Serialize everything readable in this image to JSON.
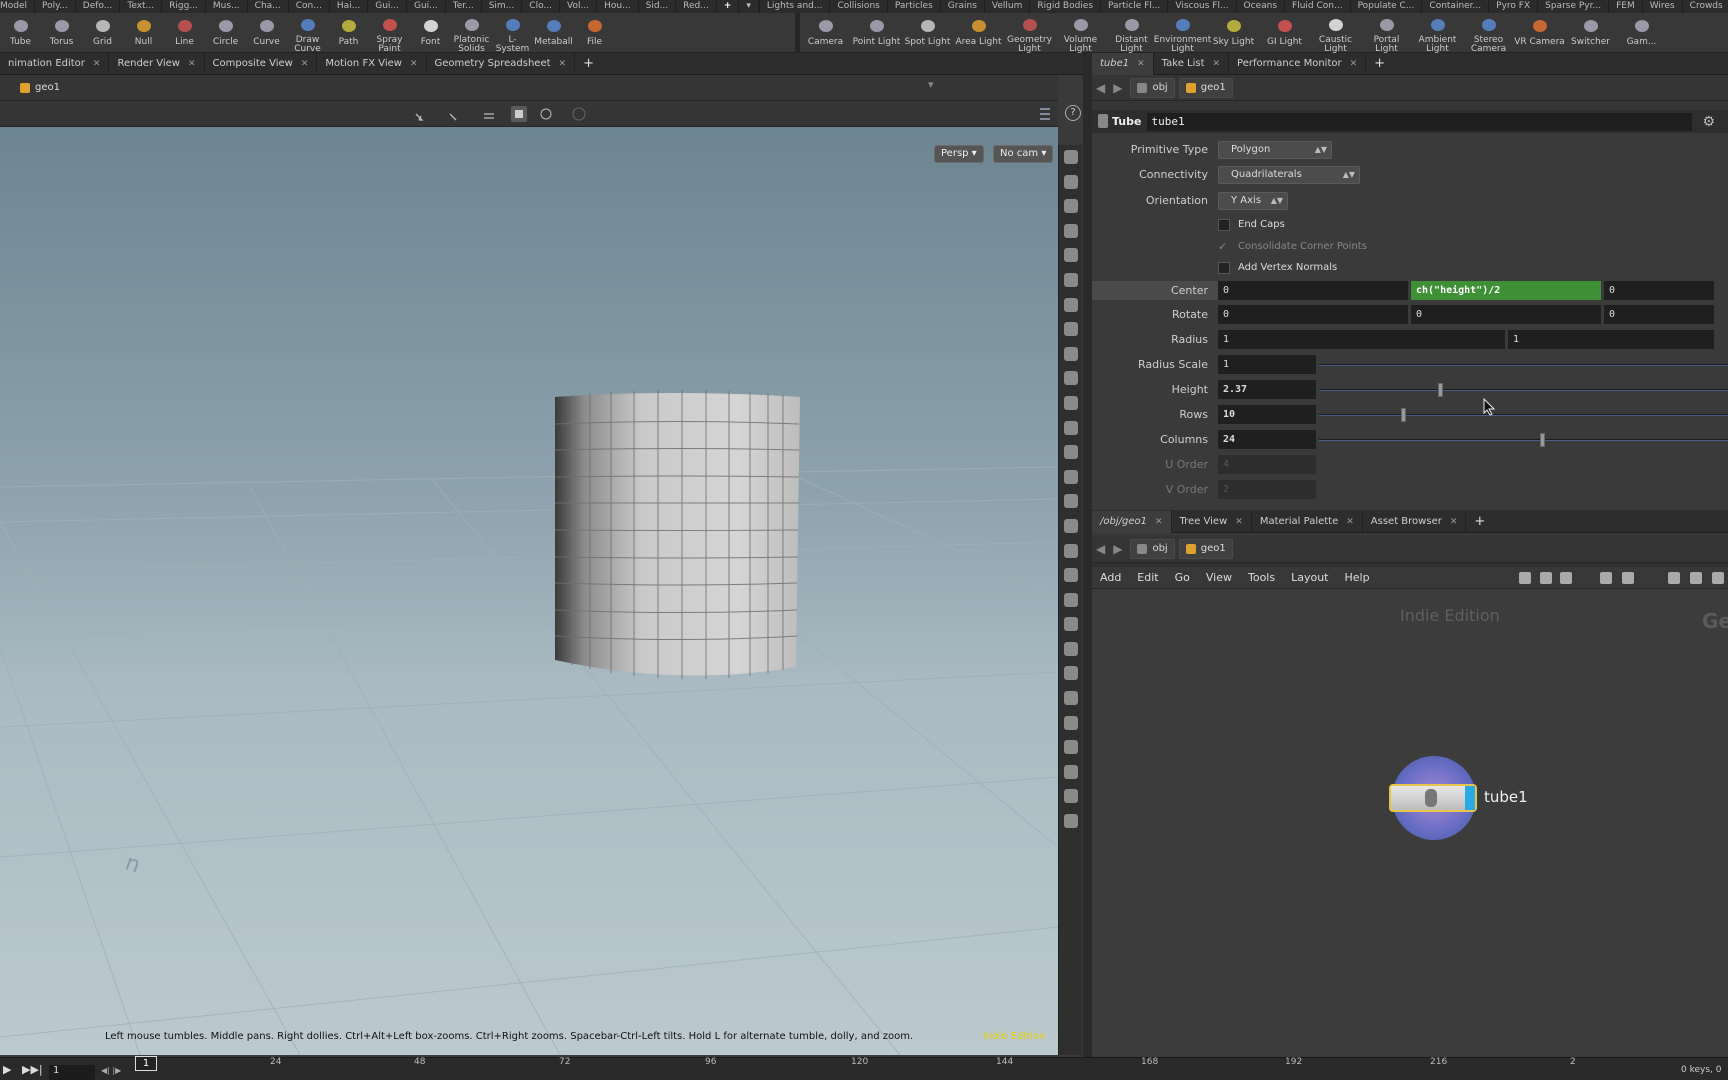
{
  "shelf_tabs_left": [
    "Model",
    "Poly...",
    "Defo...",
    "Text...",
    "Rigg...",
    "Mus...",
    "Cha...",
    "Con...",
    "Hai...",
    "Gui...",
    "Gui...",
    "Ter...",
    "Sim...",
    "Clo...",
    "Vol...",
    "Hou...",
    "Sid...",
    "Red..."
  ],
  "shelf_tabs_right": [
    "Lights and...",
    "Collisions",
    "Particles",
    "Grains",
    "Vellum",
    "Rigid Bodies",
    "Particle Fl...",
    "Viscous Fl...",
    "Oceans",
    "Fluid Con...",
    "Populate C...",
    "Container...",
    "Pyro FX",
    "Sparse Pyr...",
    "FEM",
    "Wires",
    "Crowds"
  ],
  "shelf_add": "+",
  "tools_left": [
    {
      "label": "Tube",
      "icon": "tube-icon"
    },
    {
      "label": "Torus",
      "icon": "torus-icon"
    },
    {
      "label": "Grid",
      "icon": "grid-icon"
    },
    {
      "label": "Null",
      "icon": "null-icon"
    },
    {
      "label": "Line",
      "icon": "line-icon"
    },
    {
      "label": "Circle",
      "icon": "circle-icon"
    },
    {
      "label": "Curve",
      "icon": "curve-icon"
    },
    {
      "label": "Draw Curve",
      "icon": "draw-curve-icon"
    },
    {
      "label": "Path",
      "icon": "path-icon"
    },
    {
      "label": "Spray Paint",
      "icon": "spray-paint-icon"
    },
    {
      "label": "Font",
      "icon": "font-icon"
    },
    {
      "label": "Platonic Solids",
      "icon": "platonic-solids-icon"
    },
    {
      "label": "L-System",
      "icon": "l-system-icon"
    },
    {
      "label": "Metaball",
      "icon": "metaball-icon"
    },
    {
      "label": "File",
      "icon": "file-icon"
    }
  ],
  "tools_right": [
    {
      "label": "Camera",
      "icon": "camera-icon"
    },
    {
      "label": "Point Light",
      "icon": "point-light-icon"
    },
    {
      "label": "Spot Light",
      "icon": "spot-light-icon"
    },
    {
      "label": "Area Light",
      "icon": "area-light-icon"
    },
    {
      "label": "Geometry Light",
      "icon": "geometry-light-icon"
    },
    {
      "label": "Volume Light",
      "icon": "volume-light-icon"
    },
    {
      "label": "Distant Light",
      "icon": "distant-light-icon"
    },
    {
      "label": "Environment Light",
      "icon": "environment-light-icon"
    },
    {
      "label": "Sky Light",
      "icon": "sky-light-icon"
    },
    {
      "label": "GI Light",
      "icon": "gi-light-icon"
    },
    {
      "label": "Caustic Light",
      "icon": "caustic-light-icon"
    },
    {
      "label": "Portal Light",
      "icon": "portal-light-icon"
    },
    {
      "label": "Ambient Light",
      "icon": "ambient-light-icon"
    },
    {
      "label": "Stereo Camera",
      "icon": "stereo-camera-icon"
    },
    {
      "label": "VR Camera",
      "icon": "vr-camera-icon"
    },
    {
      "label": "Switcher",
      "icon": "switcher-icon"
    },
    {
      "label": "Gam...",
      "icon": "gamepad-camera-icon"
    }
  ],
  "viewer_tabs": [
    "nimation Editor",
    "Render View",
    "Composite View",
    "Motion FX View",
    "Geometry Spreadsheet"
  ],
  "viewer_path": "geo1",
  "viewport": {
    "persp": "Persp ▾",
    "cam": "No cam ▾",
    "help": "Left mouse tumbles. Middle pans. Right dollies. Ctrl+Alt+Left box-zooms. Ctrl+Right zooms. Spacebar-Ctrl-Left tilts. Hold L for alternate tumble, dolly, and zoom.",
    "indie": "Indie Edition",
    "ground_label": "n"
  },
  "param_tabs": [
    "tube1",
    "Take List",
    "Performance Monitor"
  ],
  "param_path": [
    "obj",
    "geo1"
  ],
  "node": {
    "type": "Tube",
    "name": "tube1"
  },
  "params": {
    "primitive_type": {
      "label": "Primitive Type",
      "value": "Polygon"
    },
    "connectivity": {
      "label": "Connectivity",
      "value": "Quadrilaterals"
    },
    "orientation": {
      "label": "Orientation",
      "value": "Y Axis"
    },
    "end_caps": {
      "label": "End Caps",
      "checked": false
    },
    "consolidate": {
      "label": "Consolidate Corner Points",
      "checked": true
    },
    "add_vertex_normals": {
      "label": "Add Vertex Normals",
      "checked": false
    },
    "center": {
      "label": "Center",
      "x": "0",
      "y": "ch(\"height\")/2",
      "z": "0"
    },
    "rotate": {
      "label": "Rotate",
      "x": "0",
      "y": "0",
      "z": "0"
    },
    "radius": {
      "label": "Radius",
      "a": "1",
      "b": "1"
    },
    "radius_scale": {
      "label": "Radius Scale",
      "value": "1"
    },
    "height": {
      "label": "Height",
      "value": "2.37",
      "fraction": 0.29
    },
    "rows": {
      "label": "Rows",
      "value": "10",
      "fraction": 0.2
    },
    "columns": {
      "label": "Columns",
      "value": "24",
      "fraction": 0.54
    },
    "u_order": {
      "label": "U Order",
      "value": "4"
    },
    "v_order": {
      "label": "V Order",
      "value": "2"
    }
  },
  "net_tabs": [
    "/obj/geo1",
    "Tree View",
    "Material Palette",
    "Asset Browser"
  ],
  "net_path": [
    "obj",
    "geo1"
  ],
  "net_menu": [
    "Add",
    "Edit",
    "Go",
    "View",
    "Tools",
    "Layout",
    "Help"
  ],
  "network": {
    "indie": "Indie Edition",
    "context": "Ge",
    "node_name": "tube1"
  },
  "timeline": {
    "frame": "1",
    "current": "1",
    "ticks": [
      "24",
      "48",
      "72",
      "96",
      "120",
      "144",
      "168",
      "192",
      "216",
      "2"
    ],
    "keys": "0 keys, 0"
  },
  "colors": {
    "expr_bg": "#3e8f36",
    "node_flag": "#29a9e6",
    "node_border": "#e7c44a",
    "indie": "#e6d000"
  }
}
